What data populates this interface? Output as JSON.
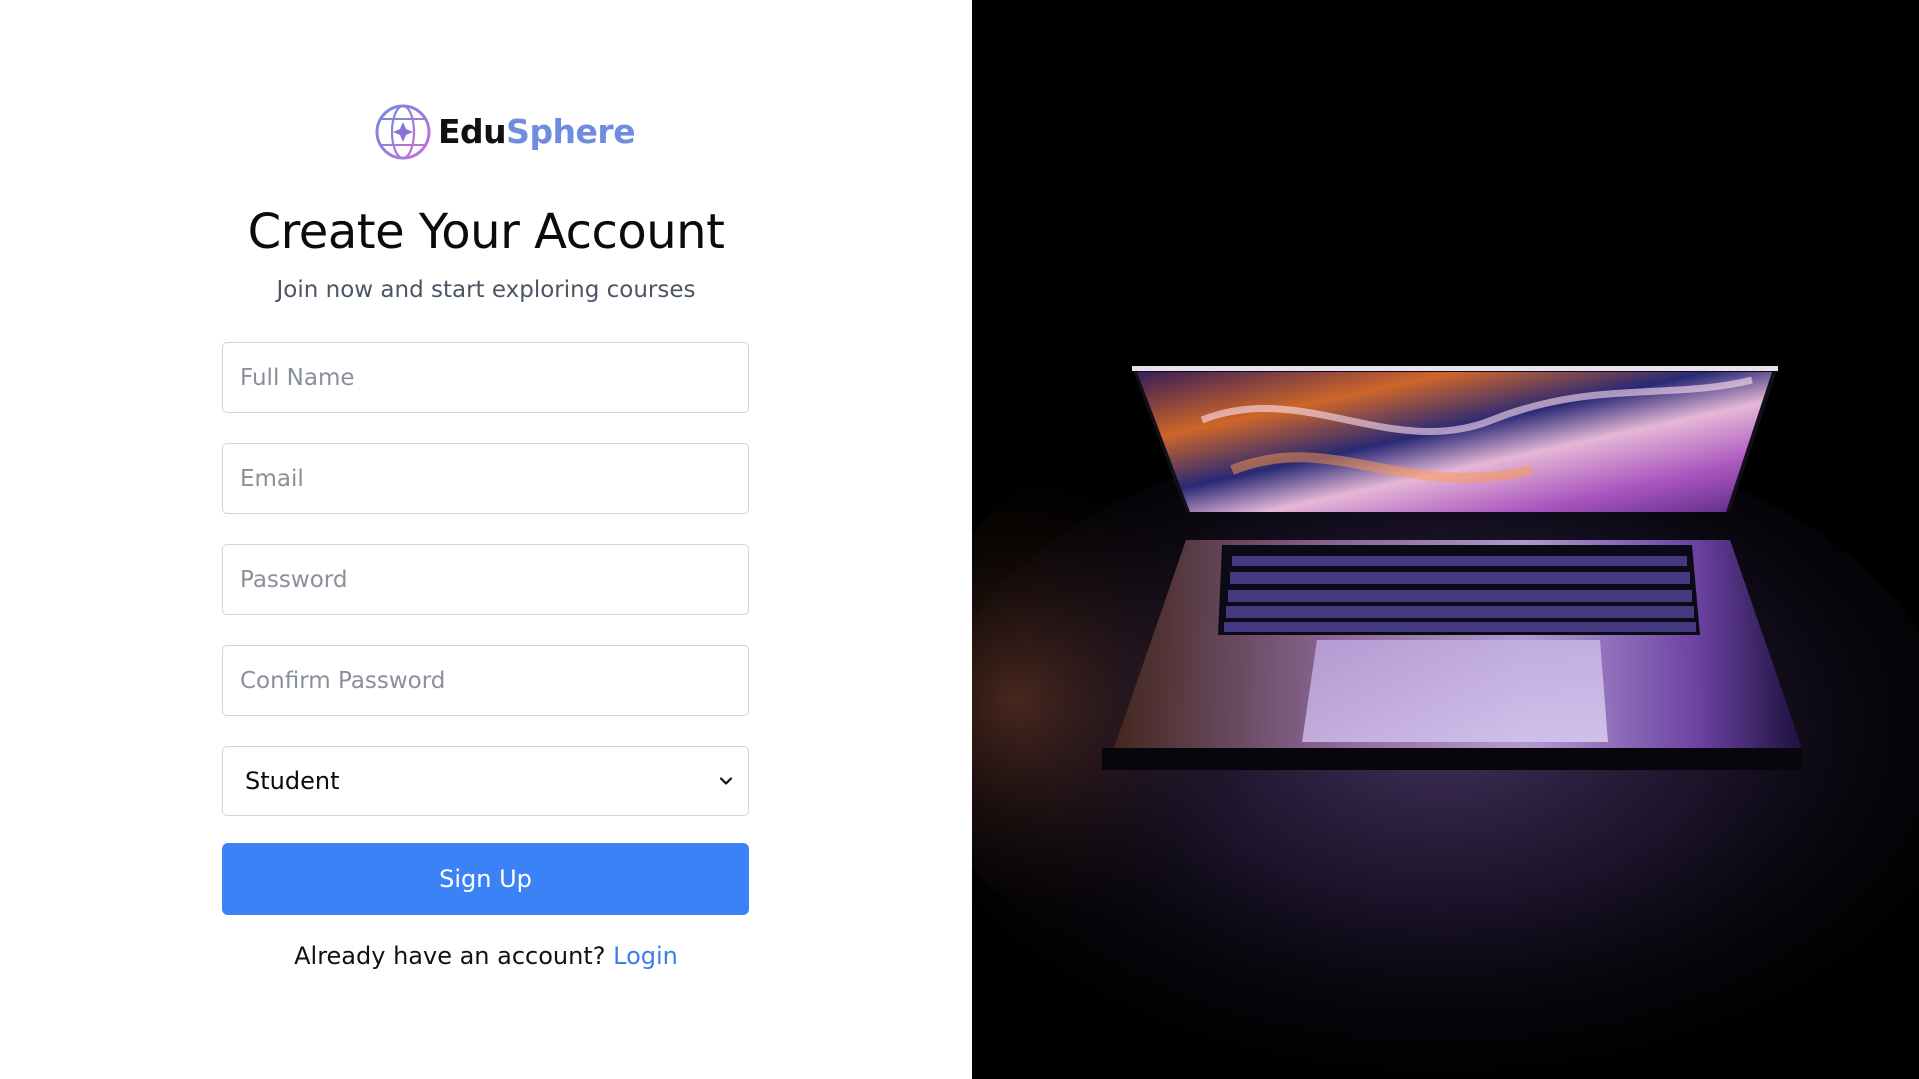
{
  "brand": {
    "name_part1": "Edu",
    "name_part2": "Sphere",
    "colors": {
      "accent": "#6f8ce0",
      "text": "#111111"
    }
  },
  "heading": {
    "title": "Create Your Account",
    "subtitle": "Join now and start exploring courses"
  },
  "form": {
    "full_name": {
      "placeholder": "Full Name",
      "value": ""
    },
    "email": {
      "placeholder": "Email",
      "value": ""
    },
    "password": {
      "placeholder": "Password",
      "value": ""
    },
    "confirm_password": {
      "placeholder": "Confirm Password",
      "value": ""
    },
    "role": {
      "selected": "Student",
      "icon": "chevron-down-icon"
    },
    "submit_label": "Sign Up",
    "submit_color": "#3b82f6"
  },
  "footer": {
    "prompt": "Already have an account?",
    "login_label": "Login",
    "link_color": "#3b7fe6"
  },
  "hero_image": {
    "subject": "laptop-image"
  }
}
